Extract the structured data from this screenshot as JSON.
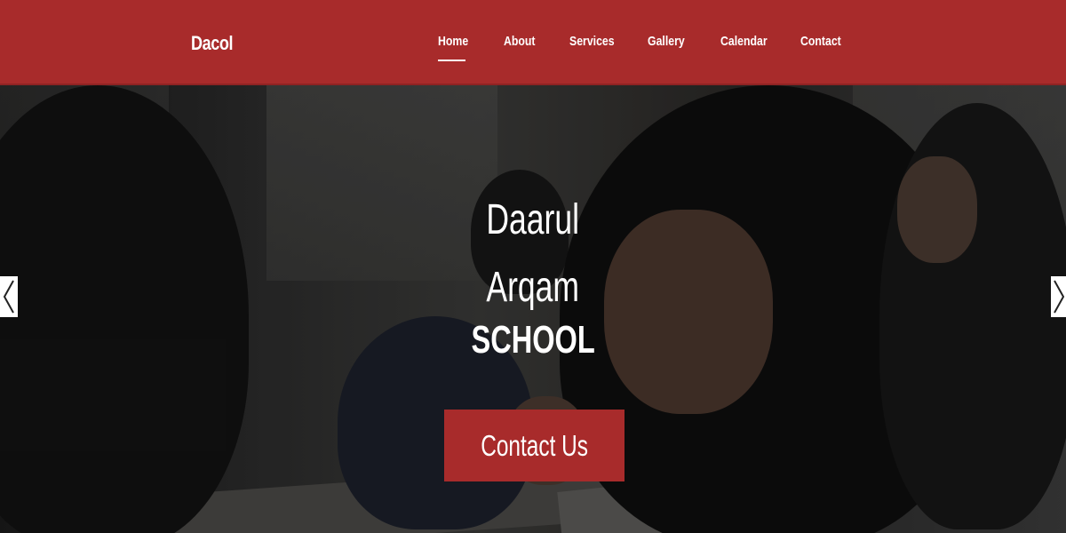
{
  "navbar": {
    "brand": "Dacol",
    "items": [
      {
        "label": "Home",
        "active": true
      },
      {
        "label": "About",
        "active": false
      },
      {
        "label": "Services",
        "active": false
      },
      {
        "label": "Gallery",
        "active": false
      },
      {
        "label": "Calendar",
        "active": false
      },
      {
        "label": "Contact",
        "active": false
      }
    ]
  },
  "hero": {
    "title_line1": "Daarul",
    "title_line2": "Arqam",
    "title_line3": "SCHOOL",
    "cta_label": "Contact Us",
    "prev_icon": "chevron-left-icon",
    "next_icon": "chevron-right-icon"
  },
  "colors": {
    "brand_red": "#a82b2b",
    "text_white": "#ffffff"
  }
}
